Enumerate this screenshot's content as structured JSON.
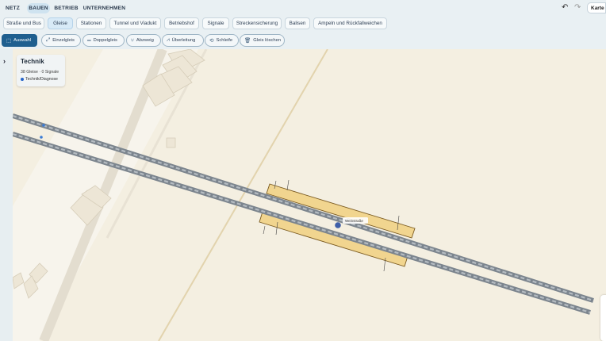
{
  "nav": {
    "items": [
      "NETZ",
      "BAUEN",
      "BETRIEB",
      "UNTERNEHMEN"
    ],
    "active": "BAUEN"
  },
  "header": {
    "map_button": "Karte",
    "undo_icon": "undo-icon",
    "redo_icon": "redo-icon"
  },
  "categories": [
    "Straße und Bus",
    "Gleise",
    "Stationen",
    "Tunnel und Viadukt",
    "Betriebshof",
    "Signale",
    "Streckensicherung",
    "Balisen",
    "Ampeln und Rückfallweichen"
  ],
  "active_category": "Gleise",
  "tools": [
    {
      "label": "Auswahl",
      "icon": "select-icon"
    },
    {
      "label": "Einzelgleis",
      "icon": "single-track-icon"
    },
    {
      "label": "Doppelgleis",
      "icon": "double-track-icon"
    },
    {
      "label": "Abzweig",
      "icon": "branch-icon"
    },
    {
      "label": "Überleitung",
      "icon": "crossover-icon"
    },
    {
      "label": "Schleife",
      "icon": "loop-icon"
    },
    {
      "label": "Gleis löschen",
      "icon": "trash-icon"
    }
  ],
  "active_tool": "Auswahl",
  "info_panel": {
    "title": "Technik",
    "stats": "38 Gleise · 0 Signale",
    "tag": "Technik/Diagnose"
  },
  "map": {
    "station_label": "Weinstraße"
  },
  "colors": {
    "accent": "#1f5f8f",
    "map_bg": "#f4efe1",
    "platform": "#f0d48c",
    "track": "#8c949c",
    "building": "#ede6d6"
  }
}
